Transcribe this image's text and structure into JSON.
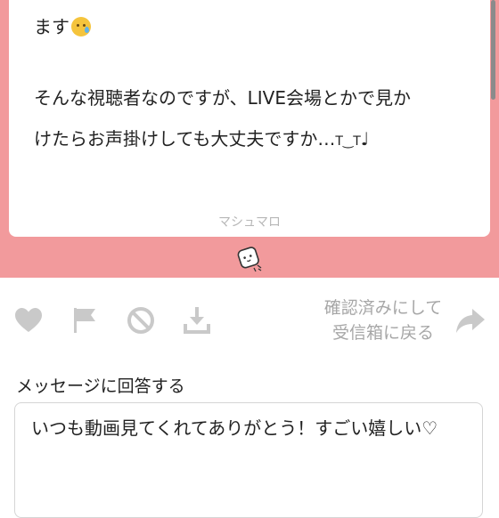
{
  "message": {
    "line1": "ます",
    "line2": "そんな視聴者なのですが、LIVE会場とかで見か",
    "line3_main": "けたらお声掛けしても大丈夫ですか…",
    "line3_face": "T‿T",
    "line3_end": "♩",
    "emoji_icon": "crying-smile-emoji",
    "watermark": "マシュマロ"
  },
  "actions": {
    "back_line1": "確認済みにして",
    "back_line2": "受信箱に戻る",
    "icons": [
      "heart-icon",
      "flag-icon",
      "block-icon",
      "download-icon",
      "reply-arrow-icon"
    ]
  },
  "answer": {
    "label": "メッセージに回答する",
    "text": "いつも動画見てくれてありがとう！すごい嬉しい♡"
  },
  "colors": {
    "band": "#f29a9c",
    "icon_gray": "#c9c9c9",
    "muted_text": "#a7a7a7"
  }
}
